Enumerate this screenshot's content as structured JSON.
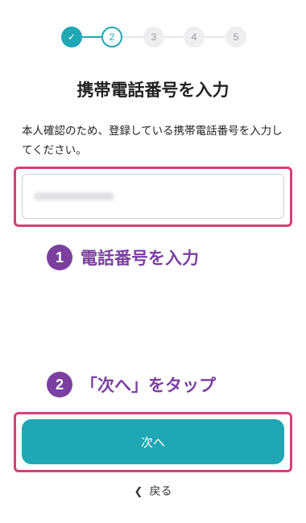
{
  "stepper": {
    "steps": [
      "✓",
      "2",
      "3",
      "4",
      "5"
    ],
    "current": 2
  },
  "title": "携帯電話番号を入力",
  "description": "本人確認のため、登録している携帯電話番号を入力してください。",
  "phone_input": {
    "value": ""
  },
  "annotations": [
    {
      "number": "1",
      "text": "電話番号を入力"
    },
    {
      "number": "2",
      "text": "「次へ」をタップ"
    }
  ],
  "next_button": {
    "label": "次へ"
  },
  "back_link": {
    "label": "戻る"
  },
  "colors": {
    "accent": "#1fa7b4",
    "highlight": "#d63f75",
    "annotation": "#7b3fa0"
  }
}
